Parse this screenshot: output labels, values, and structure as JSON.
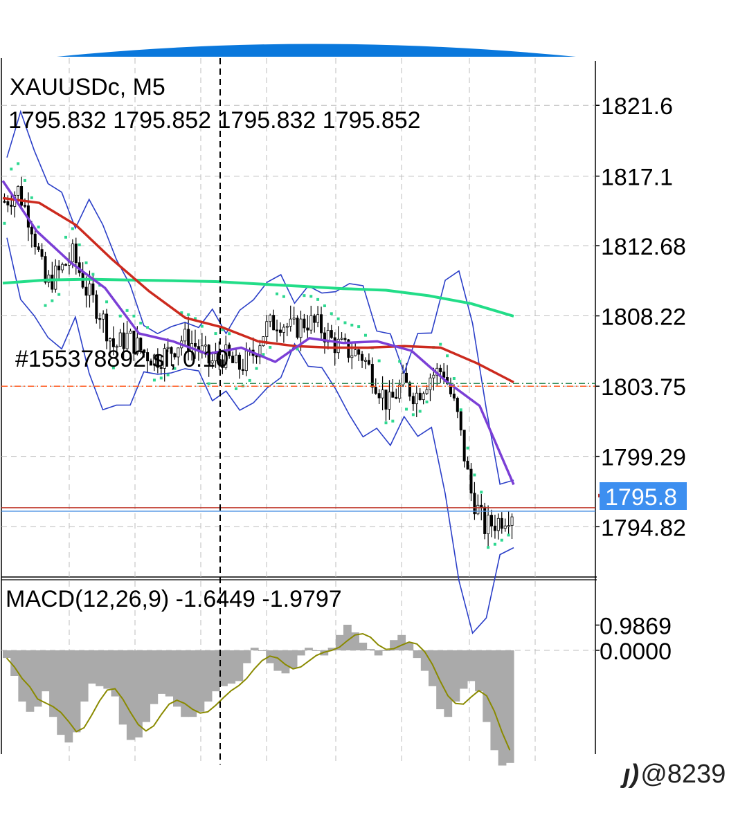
{
  "symbol_label": "XAUUSDc, M5",
  "ohlc_label": "1795.832 1795.852 1795.832 1795.852",
  "order_label": "#155378892 sl, 0.10",
  "macd_label": "MACD(12,26,9) -1.6449 -1.9797",
  "current_price_tag": "1795.8",
  "watermark": "@8239",
  "colors": {
    "ma_red": "#cc2a1e",
    "ma_green": "#22dd88",
    "ma_purple": "#7b3fd6",
    "bollinger": "#2b3fc8",
    "parabolic": "#2ed890",
    "bid_line": "#c0392b",
    "ask_line": "#4a90e2",
    "price_tag_bg": "#3d8ff0",
    "order_line": "#ff5a1f",
    "tp_line": "#2e8b57",
    "macd_hist": "#aaaaaa",
    "macd_signal": "#8a8a00",
    "header_arc": "#0a78dc"
  },
  "chart_data": [
    {
      "type": "candlestick",
      "title": "XAUUSDc, M5",
      "price_axis_ticks": [
        "1821.6",
        "1817.1",
        "1812.68",
        "1808.22",
        "1803.75",
        "1799.29",
        "1794.82"
      ],
      "price_axis_tick_values": [
        1821.6,
        1817.1,
        1812.68,
        1808.22,
        1803.75,
        1799.29,
        1794.82
      ],
      "ylim": [
        1791.8,
        1824.6
      ],
      "current_price": 1795.852,
      "order_level": 1803.75,
      "bars_count": 150,
      "close_path": [
        1815.5,
        1816.2,
        1814.0,
        1810.2,
        1811.0,
        1812.1,
        1809.8,
        1808.4,
        1806.2,
        1806.9,
        1806.0,
        1805.5,
        1805.9,
        1806.8,
        1806.3,
        1805.2,
        1805.7,
        1804.9,
        1805.6,
        1807.4,
        1808.0,
        1807.3,
        1807.9,
        1807.5,
        1806.5,
        1806.0,
        1805.8,
        1804.2,
        1802.5,
        1803.9,
        1803.2,
        1804.4,
        1804.8,
        1801.9,
        1797.0,
        1794.8,
        1795.2,
        1795.85
      ],
      "series": [
        {
          "name": "",
          "role": "ma-slow-green",
          "values": [
            1810.3,
            1810.5,
            1810.55,
            1810.5,
            1810.45,
            1810.4,
            1810.25,
            1810.1,
            1809.95,
            1809.85,
            1809.5,
            1809.0,
            1808.2
          ]
        },
        {
          "name": "",
          "role": "ma-mid-red",
          "values": [
            1815.7,
            1815.4,
            1814.0,
            1811.8,
            1809.8,
            1808.1,
            1807.5,
            1806.6,
            1806.3,
            1806.2,
            1806.2,
            1806.3,
            1806.2,
            1805.2,
            1804.0
          ]
        },
        {
          "name": "",
          "role": "ma-fast-purple",
          "values": [
            1816.8,
            1813.6,
            1811.6,
            1810.0,
            1807.1,
            1806.6,
            1805.8,
            1806.2,
            1805.3,
            1806.8,
            1806.5,
            1806.6,
            1806.0,
            1804.1,
            1802.5,
            1797.5
          ]
        }
      ]
    },
    {
      "type": "bar",
      "title": "MACD(12,26,9) -1.6449 -1.9797",
      "axis_ticks": [
        "0.9869",
        "0.0000"
      ],
      "macd_main": -1.6449,
      "macd_signal": -1.9797,
      "histogram": [
        -0.3,
        -1.0,
        -2.0,
        -2.4,
        -2.2,
        -1.6,
        -2.6,
        -3.3,
        -3.6,
        -3.2,
        -2.0,
        -1.3,
        -1.4,
        -1.5,
        -1.8,
        -2.9,
        -3.5,
        -3.4,
        -2.8,
        -2.1,
        -1.7,
        -1.8,
        -2.2,
        -2.6,
        -2.6,
        -2.4,
        -2.0,
        -1.6,
        -1.4,
        -1.3,
        -1.2,
        -0.5,
        0.1,
        0.0,
        -0.5,
        -0.8,
        -0.9,
        -0.7,
        -0.2,
        0.1,
        0.0,
        -0.2,
        0.1,
        0.6,
        1.0,
        0.7,
        0.3,
        0.05,
        -0.2,
        0.0,
        0.4,
        0.6,
        0.3,
        -0.3,
        -0.8,
        -1.4,
        -2.3,
        -2.6,
        -2.0,
        -1.5,
        -1.2,
        -1.6,
        -2.8,
        -3.9,
        -4.5,
        -4.4
      ]
    }
  ]
}
